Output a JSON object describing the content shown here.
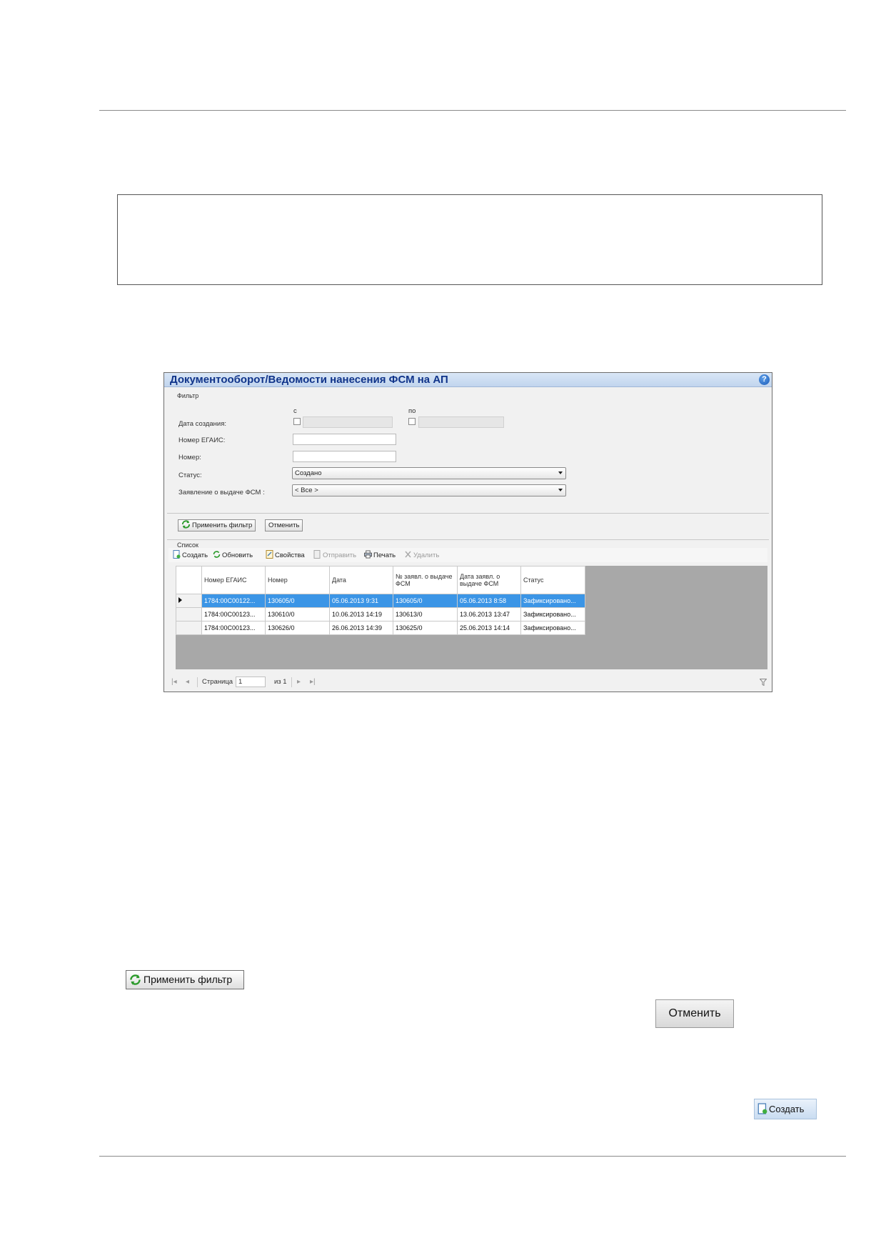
{
  "window": {
    "title": "Документооборот/Ведомости нанесения ФСМ на АП",
    "help": "?"
  },
  "filter": {
    "legend": "Фильтр",
    "from_label": "с",
    "to_label": "по",
    "date_created_label": "Дата создания:",
    "egais_number_label": "Номер ЕГАИС:",
    "number_label": "Номер:",
    "status_label": "Статус:",
    "status_value": "Создано",
    "application_label": "Заявление о выдаче ФСМ :",
    "application_value": "< Все >",
    "apply_button": "Применить фильтр",
    "cancel_button": "Отменить"
  },
  "list": {
    "legend": "Список",
    "toolbar": {
      "create": "Создать",
      "refresh": "Обновить",
      "properties": "Свойства",
      "send": "Отправить",
      "print": "Печать",
      "delete": "Удалить"
    },
    "columns": [
      "Номер ЕГАИС",
      "Номер",
      "Дата",
      "№ заявл. о выдаче ФСМ",
      "Дата заявл. о выдаче ФСМ",
      "Статус"
    ],
    "rows": [
      [
        "1784:00C00122...",
        "130605/0",
        "05.06.2013 9:31",
        "130605/0",
        "05.06.2013 8:58",
        "Зафиксировано..."
      ],
      [
        "1784:00C00123...",
        "130610/0",
        "10.06.2013 14:19",
        "130613/0",
        "13.06.2013 13:47",
        "Зафиксировано..."
      ],
      [
        "1784:00C00123...",
        "130626/0",
        "26.06.2013 14:39",
        "130625/0",
        "25.06.2013 14:14",
        "Зафиксировано..."
      ]
    ],
    "selected_row": 0
  },
  "pager": {
    "page_label": "Страница",
    "page_value": "1",
    "of_label": "из 1"
  },
  "standalone": {
    "apply_filter": "Применить фильтр",
    "cancel": "Отменить",
    "create": "Создать"
  }
}
